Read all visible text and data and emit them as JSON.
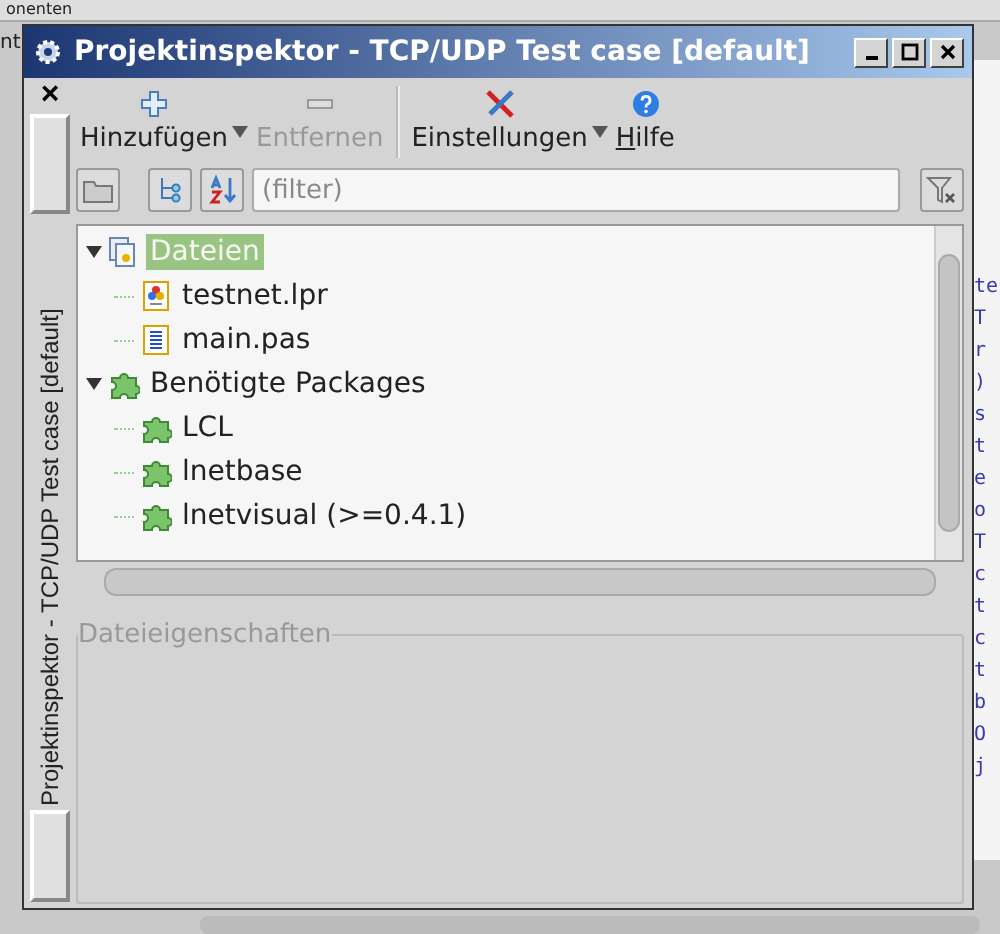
{
  "background": {
    "tab_label": "onenten",
    "side_label": "nt",
    "code_fragments": [
      "te",
      "T",
      "r",
      ")",
      "s",
      "t",
      "e",
      "o",
      "T",
      "c",
      "t",
      "c",
      "t",
      "b",
      "O",
      "j"
    ]
  },
  "window": {
    "title": "Projektinspektor - TCP/UDP Test case [default]",
    "dock_caption": "Projektinspektor - TCP/UDP Test case [default]",
    "close_glyph": "×"
  },
  "toolbar": [
    {
      "label": "Hinzufügen",
      "disabled": false,
      "dropdown": true,
      "mnemonic": false
    },
    {
      "label": "Entfernen",
      "disabled": true,
      "dropdown": false,
      "mnemonic": false
    },
    {
      "label": "Einstellungen",
      "disabled": false,
      "dropdown": true,
      "mnemonic": false
    },
    {
      "label": "Hilfe",
      "disabled": false,
      "dropdown": false,
      "mnemonic": true
    }
  ],
  "filter": {
    "placeholder": "(filter)"
  },
  "tree": [
    {
      "label": "Dateien",
      "kind": "files",
      "expanded": true,
      "selected": true,
      "children": [
        {
          "label": "testnet.lpr",
          "kind": "program",
          "selected": false
        },
        {
          "label": "main.pas",
          "kind": "unit",
          "selected": false
        }
      ]
    },
    {
      "label": "Benötigte Packages",
      "kind": "package",
      "expanded": true,
      "selected": false,
      "children": [
        {
          "label": "LCL",
          "kind": "package",
          "selected": false
        },
        {
          "label": "lnetbase",
          "kind": "package",
          "selected": false
        },
        {
          "label": "lnetvisual (>=0.4.1)",
          "kind": "package",
          "selected": false
        }
      ]
    }
  ],
  "properties": {
    "title": "Dateieigenschaften"
  }
}
